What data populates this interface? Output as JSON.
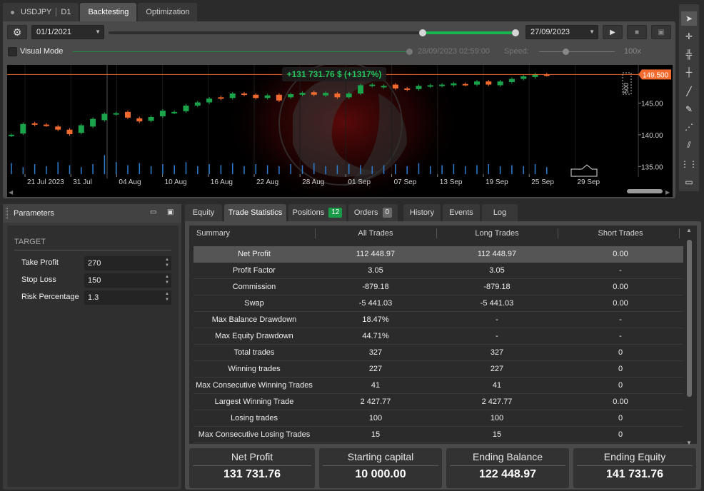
{
  "top_tabs": {
    "symbol": "USDJPY",
    "timeframe": "D1",
    "backtesting": "Backtesting",
    "optimization": "Optimization"
  },
  "toolbar": {
    "start_date": "01/1/2021",
    "end_date": "27/09/2023",
    "visual_mode_label": "Visual Mode",
    "visual_mode_checked": false,
    "visual_mode_time": "28/09/2023 02:59:00",
    "speed_label": "Speed:",
    "speed_value": "100x",
    "range_selection": [
      0.0,
      1.0
    ]
  },
  "chart": {
    "profit_banner": "+131 731.76 $ (+1317%)",
    "current_price": "149.500",
    "lot_marker": "500",
    "up_color": "#1aa34a",
    "down_color": "#f26a2e",
    "price_line_color": "#f26a2e",
    "profit_color": "#22c55e"
  },
  "chart_data": {
    "type": "candlestick",
    "y_ticks": [
      "135.00",
      "140.00",
      "145.00"
    ],
    "ylim": [
      133.8,
      151.0
    ],
    "x_ticks": [
      "21 Jul 2023",
      "31 Jul",
      "04 Aug",
      "10 Aug",
      "16 Aug",
      "22 Aug",
      "28 Aug",
      "01 Sep",
      "07 Sep",
      "13 Sep",
      "19 Sep",
      "25 Sep",
      "29 Sep"
    ],
    "candles": [
      [
        139.9,
        140.0
      ],
      [
        140.2,
        141.7
      ],
      [
        141.8,
        141.6
      ],
      [
        141.6,
        141.5
      ],
      [
        141.3,
        140.8
      ],
      [
        140.8,
        140.1
      ],
      [
        140.3,
        141.5
      ],
      [
        141.3,
        142.5
      ],
      [
        142.3,
        143.3
      ],
      [
        143.3,
        143.4
      ],
      [
        143.6,
        142.7
      ],
      [
        142.6,
        142.1
      ],
      [
        142.2,
        142.8
      ],
      [
        142.9,
        143.8
      ],
      [
        143.5,
        143.6
      ],
      [
        143.7,
        144.6
      ],
      [
        144.6,
        145.1
      ],
      [
        145.1,
        145.7
      ],
      [
        145.9,
        145.7
      ],
      [
        145.8,
        146.5
      ],
      [
        146.5,
        146.3
      ],
      [
        146.3,
        145.8
      ],
      [
        145.8,
        146.2
      ],
      [
        146.3,
        145.4
      ],
      [
        145.9,
        146.4
      ],
      [
        146.3,
        146.6
      ],
      [
        146.7,
        146.3
      ],
      [
        146.2,
        146.6
      ],
      [
        146.5,
        145.9
      ],
      [
        145.9,
        146.5
      ],
      [
        146.5,
        147.8
      ],
      [
        147.7,
        147.9
      ],
      [
        147.5,
        147.7
      ],
      [
        147.9,
        147.3
      ],
      [
        147.3,
        147.1
      ],
      [
        147.2,
        147.7
      ],
      [
        147.6,
        147.8
      ],
      [
        147.7,
        147.9
      ],
      [
        147.8,
        148.1
      ],
      [
        148.0,
        147.9
      ],
      [
        147.9,
        148.4
      ],
      [
        148.4,
        147.9
      ],
      [
        147.8,
        148.4
      ],
      [
        148.3,
        148.8
      ],
      [
        148.8,
        149.2
      ],
      [
        149.1,
        149.5
      ],
      [
        149.5,
        149.4
      ]
    ],
    "volumes": [
      0.55,
      0.35,
      0.5,
      0.4,
      0.6,
      0.45,
      0.35,
      0.5,
      0.95,
      0.6,
      0.45,
      0.55,
      0.4,
      0.5,
      0.45,
      0.6,
      0.4,
      0.5,
      0.45,
      0.55,
      0.4,
      0.5,
      0.45,
      0.4,
      0.5,
      0.45,
      0.55,
      0.4,
      0.45,
      0.5,
      0.45,
      0.4,
      0.45,
      0.5,
      0.4,
      0.55,
      0.4,
      0.45,
      0.5,
      0.4,
      0.45,
      0.5,
      0.4,
      0.45,
      0.4,
      0.5,
      0.35
    ]
  },
  "parameters": {
    "title": "Parameters",
    "group": "TARGET",
    "items": [
      {
        "label": "Take Profit",
        "value": "270"
      },
      {
        "label": "Stop Loss",
        "value": "150"
      },
      {
        "label": "Risk Percentage",
        "value": "1.3"
      }
    ]
  },
  "stats_tabs": {
    "equity": "Equity",
    "trade_statistics": "Trade Statistics",
    "positions": "Positions",
    "positions_count": "12",
    "orders": "Orders",
    "orders_count": "0",
    "history": "History",
    "events": "Events",
    "log": "Log"
  },
  "table": {
    "headers": [
      "Summary",
      "All Trades",
      "Long Trades",
      "Short Trades"
    ],
    "rows": [
      [
        "Net Profit",
        "112 448.97",
        "112 448.97",
        "0.00"
      ],
      [
        "Profit Factor",
        "3.05",
        "3.05",
        "-"
      ],
      [
        "Commission",
        "-879.18",
        "-879.18",
        "0.00"
      ],
      [
        "Swap",
        "-5 441.03",
        "-5 441.03",
        "0.00"
      ],
      [
        "Max Balance Drawdown",
        "18.47%",
        "-",
        "-"
      ],
      [
        "Max Equity Drawdown",
        "44.71%",
        "-",
        "-"
      ],
      [
        "Total trades",
        "327",
        "327",
        "0"
      ],
      [
        "Winning trades",
        "227",
        "227",
        "0"
      ],
      [
        "Max Consecutive Winning Trades",
        "41",
        "41",
        "0"
      ],
      [
        "Largest Winning Trade",
        "2 427.77",
        "2 427.77",
        "0.00"
      ],
      [
        "Losing trades",
        "100",
        "100",
        "0"
      ],
      [
        "Max Consecutive Losing Trades",
        "15",
        "15",
        "0"
      ]
    ]
  },
  "summary_cards": [
    {
      "title": "Net Profit",
      "value": "131 731.76"
    },
    {
      "title": "Starting capital",
      "value": "10 000.00"
    },
    {
      "title": "Ending Balance",
      "value": "122 448.97"
    },
    {
      "title": "Ending Equity",
      "value": "141 731.76"
    }
  ]
}
